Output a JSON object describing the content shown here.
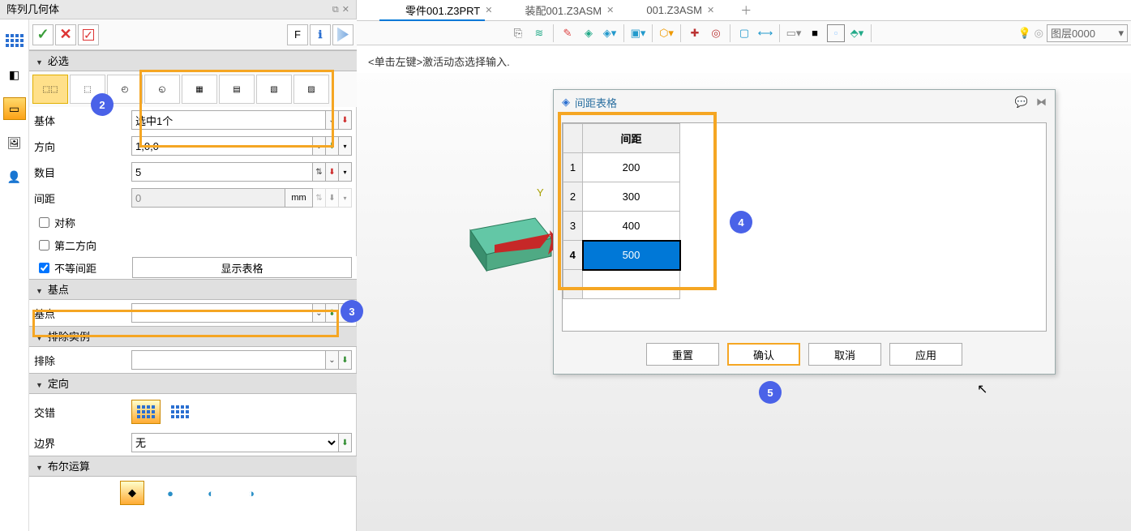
{
  "panel": {
    "title": "阵列几何体",
    "toolbar": {
      "f": "F"
    },
    "sections": {
      "required": "必选",
      "base_point": "基点",
      "exclude": "排除实例",
      "orient": "定向",
      "boolean": "布尔运算"
    },
    "labels": {
      "base_entity": "基体",
      "direction": "方向",
      "count": "数目",
      "spacing": "间距",
      "symmetric": "对称",
      "second_dir": "第二方向",
      "unequal": "不等间距",
      "show_table": "显示表格",
      "base_point": "基点",
      "exclude": "排除",
      "stagger": "交错",
      "boundary": "边界"
    },
    "values": {
      "base_entity": "选中1个",
      "direction": "1,0,0",
      "count": "5",
      "spacing": "0",
      "spacing_unit": "mm",
      "boundary": "无",
      "unequal_checked": true
    }
  },
  "work": {
    "tabs": [
      {
        "label": "零件001.Z3PRT",
        "active": true
      },
      {
        "label": "装配001.Z3ASM",
        "active": false
      },
      {
        "label": "001.Z3ASM",
        "active": false
      }
    ],
    "hint": "<单击左键>激活动态选择输入.",
    "layer": "图层0000"
  },
  "dialog": {
    "title": "间距表格",
    "header": "间距",
    "rows": [
      {
        "idx": "1",
        "val": "200",
        "sel": false
      },
      {
        "idx": "2",
        "val": "300",
        "sel": false
      },
      {
        "idx": "3",
        "val": "400",
        "sel": false
      },
      {
        "idx": "4",
        "val": "500",
        "sel": true
      }
    ],
    "buttons": {
      "reset": "重置",
      "ok": "确认",
      "cancel": "取消",
      "apply": "应用"
    }
  },
  "badges": {
    "b2": "2",
    "b3": "3",
    "b4": "4",
    "b5": "5"
  }
}
